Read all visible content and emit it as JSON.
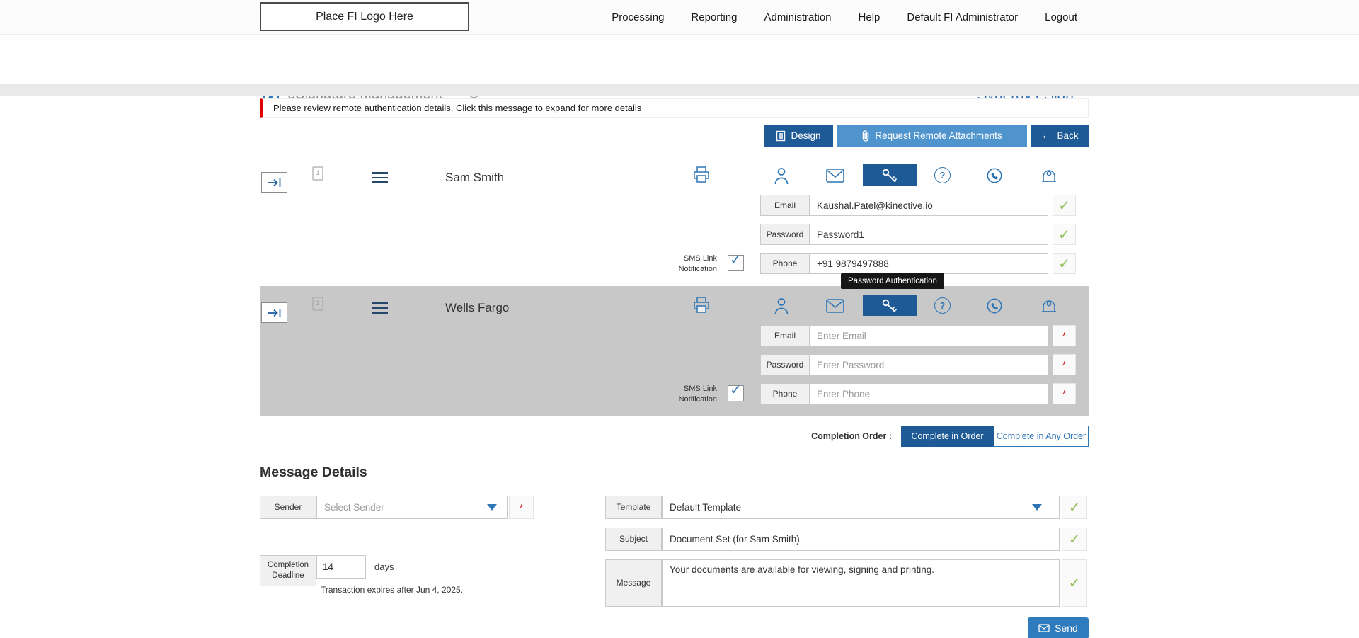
{
  "topbar": {
    "logo": "Place FI Logo Here",
    "nav": [
      "Processing",
      "Reporting",
      "Administration",
      "Help",
      "Default FI Administrator",
      "Logout"
    ]
  },
  "header": {
    "title": "eSignature Management",
    "brand": "Synergy eSign™"
  },
  "alert": "Please review remote authentication details. Click this message to expand for more details",
  "toolbar": {
    "design": "Design",
    "request_remote_attachments": "Request Remote Attachments",
    "back": "Back"
  },
  "icons": {
    "check": "✓",
    "checkbox_check": "✓",
    "required": "*",
    "back_arrow": "←",
    "info": "i",
    "question": "?"
  },
  "labels": {
    "email": "Email",
    "password": "Password",
    "phone": "Phone",
    "sms": "SMS Link Notification"
  },
  "recipients": [
    {
      "name": "Sam Smith",
      "email": "Kaushal.Patel@kinective.io",
      "password": "Password1",
      "phone": "+91 9879497888"
    },
    {
      "name": "Wells Fargo",
      "email_placeholder": "Enter Email",
      "password_placeholder": "Enter Password",
      "phone_placeholder": "Enter Phone"
    }
  ],
  "tooltip": "Password Authentication",
  "completion_order": {
    "label": "Completion Order :",
    "in_order": "Complete in Order",
    "any_order": "Complete in Any Order"
  },
  "message_details": {
    "heading": "Message Details",
    "sender_label": "Sender",
    "sender_placeholder": "Select Sender",
    "deadline_label": "Completion Deadline",
    "deadline_value": "14",
    "deadline_unit": "days",
    "expiry_note": "Transaction expires after Jun 4, 2025.",
    "template_label": "Template",
    "template_value": "Default Template",
    "subject_label": "Subject",
    "subject_value": "Document Set (for Sam Smith)",
    "message_label": "Message",
    "message_value": "Your documents are available for viewing, signing and printing.",
    "send": "Send"
  },
  "colors": {
    "accent_blue": "#1d5a96",
    "light_blue": "#4f94cd",
    "brand_blue": "#2a6db5",
    "alert_red": "#e00000",
    "check_green": "#8fbe56",
    "selected_row_gray": "#c8c8c8"
  }
}
